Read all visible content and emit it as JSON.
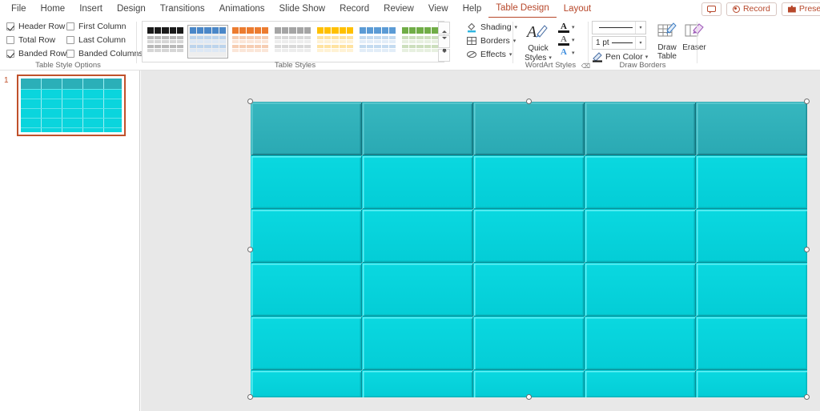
{
  "app": {
    "tabs": [
      {
        "label": "File",
        "state": "normal"
      },
      {
        "label": "Home",
        "state": "normal"
      },
      {
        "label": "Insert",
        "state": "normal"
      },
      {
        "label": "Design",
        "state": "normal"
      },
      {
        "label": "Transitions",
        "state": "normal"
      },
      {
        "label": "Animations",
        "state": "normal"
      },
      {
        "label": "Slide Show",
        "state": "normal"
      },
      {
        "label": "Record",
        "state": "normal"
      },
      {
        "label": "Review",
        "state": "normal"
      },
      {
        "label": "View",
        "state": "normal"
      },
      {
        "label": "Help",
        "state": "normal"
      },
      {
        "label": "Table Design",
        "state": "active"
      },
      {
        "label": "Layout",
        "state": "contextual"
      }
    ],
    "top_right": {
      "comment_icon": "comment-bubble-icon",
      "record_label": "Record",
      "record_icon": "record-dot-icon",
      "present_label": "Present",
      "present_icon": "present-screen-icon"
    }
  },
  "ribbon": {
    "groups": {
      "table_style_options": {
        "label": "Table Style Options",
        "checkboxes": [
          {
            "label": "Header Row",
            "checked": true
          },
          {
            "label": "First Column",
            "checked": false
          },
          {
            "label": "Total Row",
            "checked": false
          },
          {
            "label": "Last Column",
            "checked": false
          },
          {
            "label": "Banded Rows",
            "checked": true
          },
          {
            "label": "Banded Columns",
            "checked": false
          }
        ]
      },
      "table_styles": {
        "label": "Table Styles",
        "selected_index": 1,
        "thumbnails": [
          {
            "name": "No Style, Table Grid (Dark)",
            "header": "#1a1a1a",
            "body": "#b9b9b9",
            "alt": "#d6d6d6"
          },
          {
            "name": "Light Style 2 Accent 1 (Blue)",
            "header": "#4a87c8",
            "body": "#bcd4ec",
            "alt": "#dde8f5"
          },
          {
            "name": "Light Style 2 Accent 2 (Orange)",
            "header": "#ec7c30",
            "body": "#f6cdb2",
            "alt": "#fbe6d8"
          },
          {
            "name": "Light Style 2 Accent 3 (Gray)",
            "header": "#a5a5a5",
            "body": "#d9d9d9",
            "alt": "#ededed"
          },
          {
            "name": "Light Style 2 Accent 4 (Gold)",
            "header": "#ffc000",
            "body": "#ffe3a0",
            "alt": "#fff2d4"
          },
          {
            "name": "Light Style 2 Accent 5 (Light Blue)",
            "header": "#5b9bd5",
            "body": "#c4dbf0",
            "alt": "#e2edf8"
          },
          {
            "name": "Light Style 2 Accent 6 (Green)",
            "header": "#70ad47",
            "body": "#ccdfbd",
            "alt": "#e7f0e0"
          }
        ],
        "scroll_up": "scroll-up-button",
        "scroll_down": "scroll-down-button",
        "more": "more-styles-button"
      },
      "shading_borders_effects": {
        "items": [
          {
            "label": "Shading",
            "icon": "shading-paint-icon",
            "has_dropdown": true
          },
          {
            "label": "Borders",
            "icon": "borders-grid-icon",
            "has_dropdown": true
          },
          {
            "label": "Effects",
            "icon": "effects-bevel-icon",
            "has_dropdown": true
          }
        ]
      },
      "wordart_styles": {
        "label": "WordArt Styles",
        "quick_styles_label_line1": "Quick",
        "quick_styles_label_line2": "Styles",
        "quick_styles_icon": "wordart-quick-styles-icon",
        "buttons": [
          {
            "name": "text-fill",
            "glyph": "A",
            "underline": "#1a1a1a",
            "glyph_color": "#1a1a1a"
          },
          {
            "name": "text-outline",
            "glyph": "A",
            "underline": "#1a1a1a",
            "glyph_color": "#5a5a5a"
          },
          {
            "name": "text-effects",
            "glyph": "A",
            "underline": "transparent",
            "glyph_color": "#3f8ede"
          }
        ],
        "dialog_launcher": "wordart-dialog-launcher"
      },
      "draw_borders": {
        "label": "Draw Borders",
        "pen_style_value": "",
        "pen_weight_value": "1 pt",
        "pen_color_label": "Pen Color",
        "pen_color_icon": "pen-color-icon",
        "draw_table_line1": "Draw",
        "draw_table_line2": "Table",
        "draw_table_icon": "draw-table-icon",
        "eraser_label": "Eraser",
        "eraser_icon": "eraser-icon"
      }
    }
  },
  "slide_panel": {
    "slides": [
      {
        "number": "1",
        "selected": true
      }
    ]
  },
  "canvas": {
    "table": {
      "rows": 6,
      "columns": 5,
      "header_row_color": "#2BAFB8",
      "body_row_color": "#0AD5DD",
      "gridline_color": "#0A8F98",
      "selected": true,
      "handles": [
        "top-left",
        "top-center",
        "top-right",
        "middle-left",
        "middle-right",
        "bottom-left",
        "bottom-center",
        "bottom-right"
      ],
      "cells": [
        [
          "",
          "",
          "",
          "",
          ""
        ],
        [
          "",
          "",
          "",
          "",
          ""
        ],
        [
          "",
          "",
          "",
          "",
          ""
        ],
        [
          "",
          "",
          "",
          "",
          ""
        ],
        [
          "",
          "",
          "",
          "",
          ""
        ],
        [
          "",
          "",
          "",
          "",
          ""
        ]
      ]
    }
  }
}
